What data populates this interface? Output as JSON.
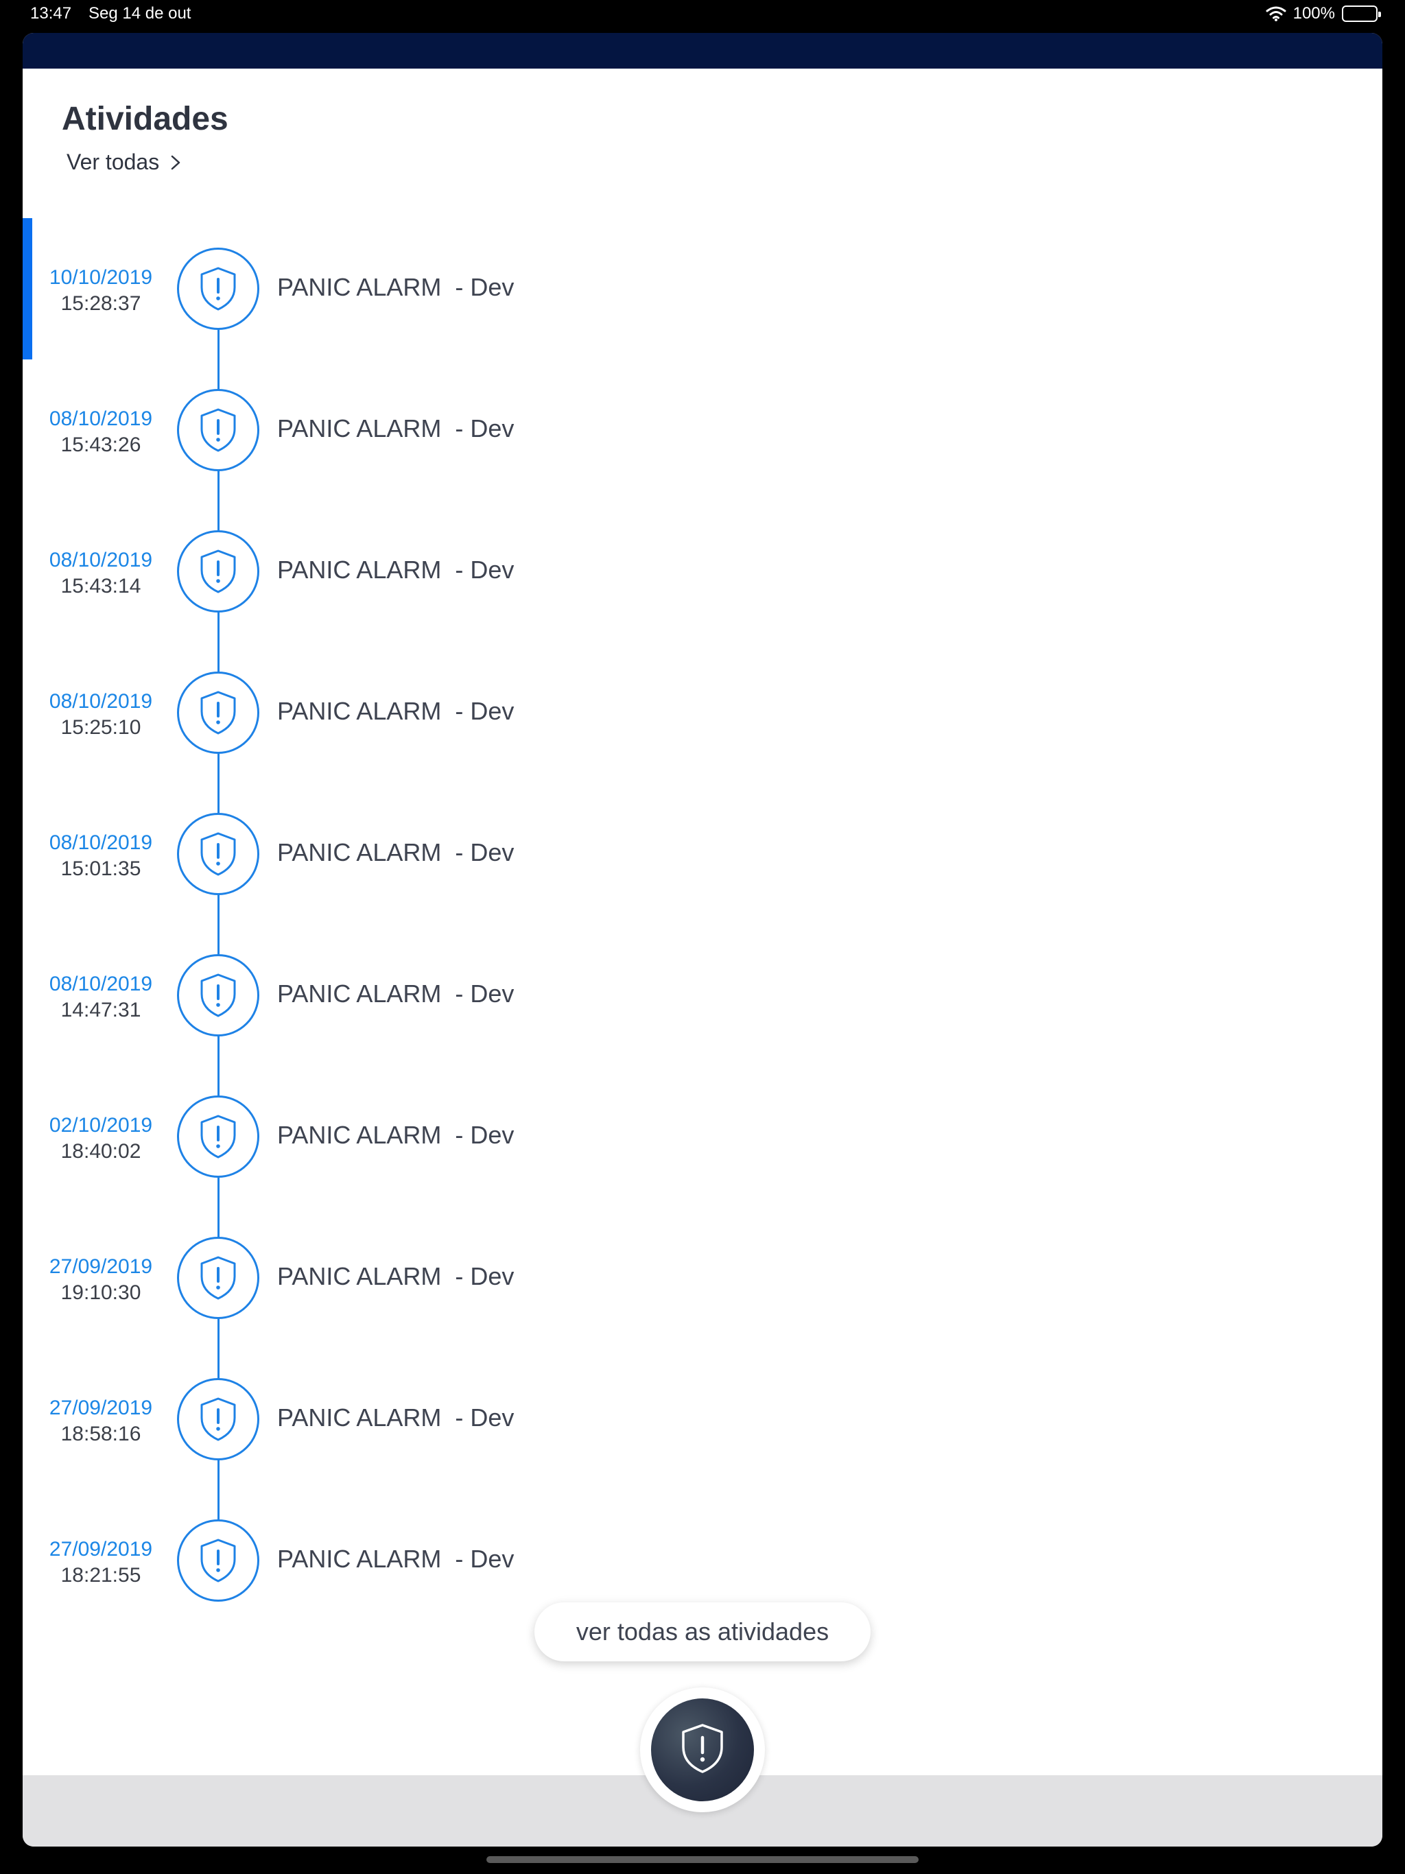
{
  "status_bar": {
    "time": "13:47",
    "date": "Seg 14 de out",
    "battery": "100%"
  },
  "header": {
    "title": "Atividades",
    "see_all_link": "Ver todas"
  },
  "activities": [
    {
      "date": "10/10/2019",
      "time": "15:28:37",
      "event": "PANIC ALARM  - Dev"
    },
    {
      "date": "08/10/2019",
      "time": "15:43:26",
      "event": "PANIC ALARM  - Dev"
    },
    {
      "date": "08/10/2019",
      "time": "15:43:14",
      "event": "PANIC ALARM  - Dev"
    },
    {
      "date": "08/10/2019",
      "time": "15:25:10",
      "event": "PANIC ALARM  - Dev"
    },
    {
      "date": "08/10/2019",
      "time": "15:01:35",
      "event": "PANIC ALARM  - Dev"
    },
    {
      "date": "08/10/2019",
      "time": "14:47:31",
      "event": "PANIC ALARM  - Dev"
    },
    {
      "date": "02/10/2019",
      "time": "18:40:02",
      "event": "PANIC ALARM  - Dev"
    },
    {
      "date": "27/09/2019",
      "time": "19:10:30",
      "event": "PANIC ALARM  - Dev"
    },
    {
      "date": "27/09/2019",
      "time": "18:58:16",
      "event": "PANIC ALARM  - Dev"
    },
    {
      "date": "27/09/2019",
      "time": "18:21:55",
      "event": "PANIC ALARM  - Dev"
    }
  ],
  "footer": {
    "see_all_button": "ver todas as atividades"
  },
  "icons": {
    "event": "shield-alert-icon",
    "fab": "shield-alert-icon"
  },
  "colors": {
    "accent": "#1b86e6",
    "top_bar": "#041541",
    "fab": "#2a3346"
  }
}
